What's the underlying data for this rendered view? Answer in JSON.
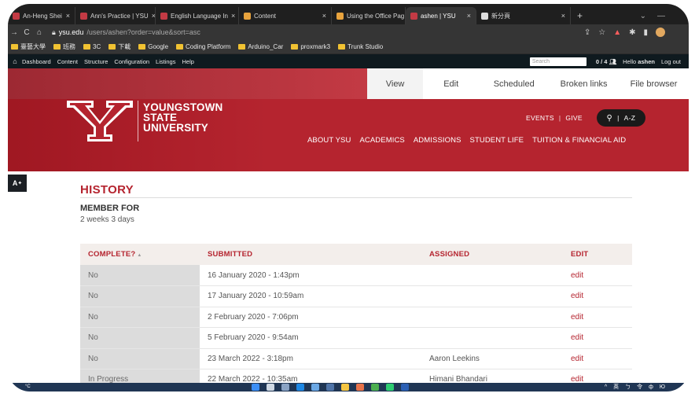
{
  "browser": {
    "tabs": [
      {
        "label": "An-Heng Shei",
        "fav_color": "#c33a44",
        "active": false
      },
      {
        "label": "Ann's Practice | YSU",
        "fav_color": "#c33a44",
        "active": false
      },
      {
        "label": "English Language In",
        "fav_color": "#c33a44",
        "active": false
      },
      {
        "label": "Content",
        "fav_color": "#e8a33d",
        "active": false
      },
      {
        "label": "Using the Office Pag",
        "fav_color": "#e8a33d",
        "active": false
      },
      {
        "label": "ashen | YSU",
        "fav_color": "#c33a44",
        "active": true
      },
      {
        "label": "新分頁",
        "fav_color": "#dddddd",
        "active": false
      }
    ],
    "new_tab": "+",
    "url_domain": "ysu.edu",
    "url_path": "/users/ashen?order=value&sort=asc",
    "bookmarks": [
      "臺藝大學",
      "班務",
      "3C",
      "下載",
      "Google",
      "Coding Platform",
      "Arduino_Car",
      "proxmark3",
      "Trunk Studio"
    ]
  },
  "admin": {
    "menu": [
      "Dashboard",
      "Content",
      "Structure",
      "Configuration",
      "Listings",
      "Help"
    ],
    "search_placeholder": "Search",
    "count": "0 / 4",
    "greeting_prefix": "Hello",
    "username": "ashen",
    "logout": "Log out"
  },
  "local_tabs": [
    "View",
    "Edit",
    "Scheduled",
    "Broken links",
    "File browser"
  ],
  "site": {
    "logo_lines": [
      "YOUNGSTOWN",
      "STATE",
      "UNIVERSITY"
    ],
    "util_events": "EVENTS",
    "util_give": "GIVE",
    "util_az": "A-Z",
    "nav": [
      "ABOUT YSU",
      "ACADEMICS",
      "ADMISSIONS",
      "STUDENT LIFE",
      "TUITION & FINANCIAL AID"
    ],
    "brand_color": "#b5242f"
  },
  "a11y_label": "A",
  "history": {
    "title": "HISTORY",
    "member_label": "MEMBER FOR",
    "member_value": "2 weeks 3 days"
  },
  "table": {
    "headers": [
      "COMPLETE?",
      "SUBMITTED",
      "ASSIGNED",
      "EDIT"
    ],
    "rows": [
      {
        "complete": "No",
        "submitted": "16 January 2020 - 1:43pm",
        "assigned": "",
        "edit": "edit"
      },
      {
        "complete": "No",
        "submitted": "17 January 2020 - 10:59am",
        "assigned": "",
        "edit": "edit"
      },
      {
        "complete": "No",
        "submitted": "2 February 2020 - 7:06pm",
        "assigned": "",
        "edit": "edit"
      },
      {
        "complete": "No",
        "submitted": "5 February 2020 - 9:54am",
        "assigned": "",
        "edit": "edit"
      },
      {
        "complete": "No",
        "submitted": "23 March 2022 - 3:18pm",
        "assigned": "Aaron Leekins",
        "edit": "edit"
      },
      {
        "complete": "In Progress",
        "submitted": "22 March 2022 - 10:35am",
        "assigned": "Himani Bhandari",
        "edit": "edit"
      }
    ]
  },
  "taskbar": {
    "weather": "°C",
    "tray": [
      "^",
      "英",
      "ㄅ",
      "令",
      "ф",
      "Ю"
    ]
  }
}
